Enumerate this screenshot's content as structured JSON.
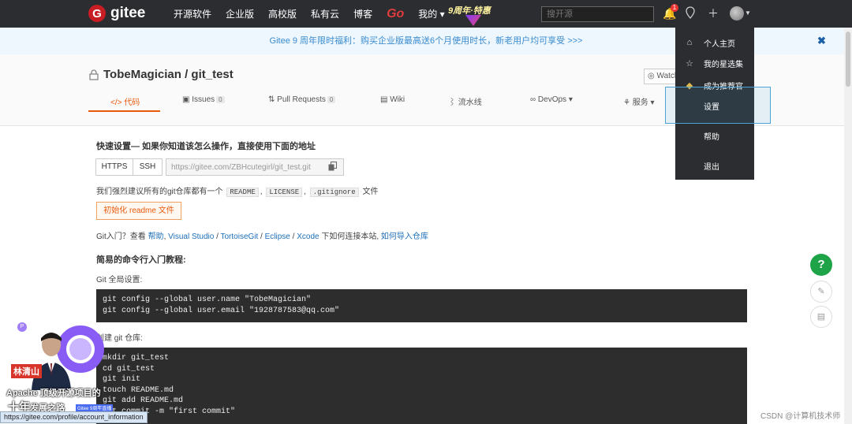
{
  "topnav": {
    "logo_letter": "G",
    "logo_text": "gitee",
    "items": [
      "开源软件",
      "企业版",
      "高校版",
      "私有云",
      "博客"
    ],
    "go_label": "Go",
    "mine_label": "我的 ▾",
    "promo_text": "9周年·特惠",
    "search_placeholder": "搜开源",
    "notification_count": "1"
  },
  "notice": {
    "text": "Gitee 9 周年限时福利：购买企业版最高送6个月使用时长，新老用户均可享受 >>>",
    "close": "✖"
  },
  "repo": {
    "title": "TobeMagician / git_test",
    "watch_label": "◎ Watch"
  },
  "tabs": [
    {
      "label": "</> 代码"
    },
    {
      "label": "Issues",
      "count": "0"
    },
    {
      "label": "Pull Requests",
      "count": "0"
    },
    {
      "label": "Wiki"
    },
    {
      "label": "流水线"
    },
    {
      "label": "DevOps ▾"
    },
    {
      "label": "服务 ▾"
    }
  ],
  "quick_setup": {
    "heading": "快速设置— 如果你知道该怎么操作，直接使用下面的地址",
    "https_label": "HTTPS",
    "ssh_label": "SSH",
    "url": "https://gitee.com/ZBHcutegirl/git_test.git",
    "suggest_prefix": "我们强烈建议所有的git仓库都有一个",
    "chip_readme": "README",
    "chip_license": "LICENSE",
    "chip_gitignore": ".gitignore",
    "suggest_suffix": "文件",
    "sep1": ",",
    "sep2": ",",
    "init_button": "初始化 readme 文件",
    "help_prefix": "Git入门？查看 ",
    "help_link": "帮助",
    "sep_a": ", ",
    "vs_link": "Visual Studio",
    "sep_b": " / ",
    "tgit_link": "TortoiseGit",
    "sep_c": " / ",
    "eclipse_link": "Eclipse",
    "sep_d": " / ",
    "xcode_link": "Xcode",
    "help_mid": " 下如何连接本站, ",
    "import_link": "如何导入仓库"
  },
  "tutorial": {
    "heading": "简易的命令行入门教程:",
    "global_label": "Git 全局设置:",
    "global_code": "git config --global user.name \"TobeMagician\"\ngit config --global user.email \"1928787583@qq.com\"",
    "create_label": "创建 git 仓库:",
    "create_code": "mkdir git_test\ncd git_test\ngit init\ntouch README.md\ngit add README.md\ngit commit -m \"first commit\""
  },
  "dropdown": {
    "items": [
      {
        "icon": "⌂",
        "label": "个人主页"
      },
      {
        "icon": "☆",
        "label": "我的星选集"
      },
      {
        "icon": "◆",
        "label": "成为推荐官"
      },
      {
        "label": "设置"
      },
      {
        "label": "帮助"
      },
      {
        "label": "退出"
      }
    ]
  },
  "fab": {
    "help": "?",
    "edit": "✎",
    "chat": "▤"
  },
  "overlay": {
    "name": "林清山",
    "line1": "Apache 顶级开源项目的",
    "line2_big": "十年",
    "line2_small": "发展之路",
    "badge": "Gitee 9周年直播",
    "p_icon": "P"
  },
  "statusbar": {
    "url": "https://gitee.com/profile/account_information"
  },
  "watermark": "CSDN @计算机技术师"
}
